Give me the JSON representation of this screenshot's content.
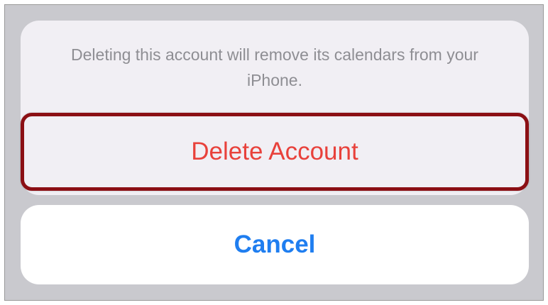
{
  "action_sheet": {
    "message": "Deleting this account will remove its calendars from your iPhone.",
    "destructive_label": "Delete Account",
    "cancel_label": "Cancel"
  },
  "colors": {
    "destructive": "#e8413b",
    "cancel": "#1f7ef0",
    "highlight_border": "#8b0f14",
    "message_text": "#8e8e93"
  }
}
